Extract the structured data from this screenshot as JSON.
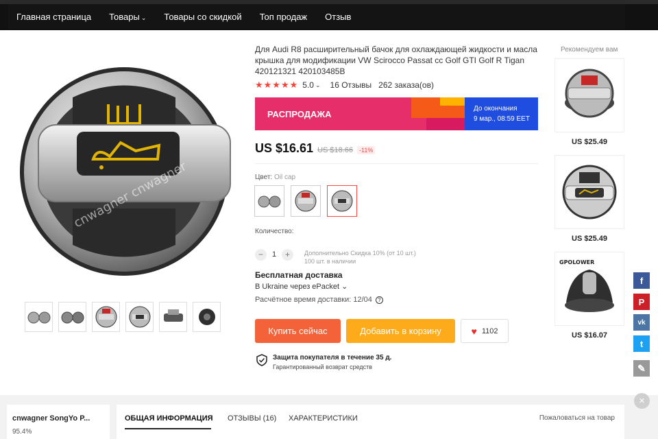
{
  "nav": {
    "items": [
      "Главная страница",
      "Товары",
      "Товары со скидкой",
      "Топ продаж",
      "Отзыв"
    ]
  },
  "product": {
    "title": "Для Audi R8 расширительный бачок для охлаждающей жидкости и масла крышка для модификации VW Scirocco Passat cc Golf GTI Golf R Tigan 420121321 420103485B",
    "stars": "★★★★★",
    "rating": "5.0",
    "reviews": "16 Отзывы",
    "orders": "262 заказа(ов)",
    "photo_watermark": "cnwagner cnwagner"
  },
  "sale": {
    "label": "РАСПРОДАЖА",
    "timer_title": "До окончания",
    "timer_value": "9 мар., 08:59 EET",
    "colors": {
      "banner": "#e62e6b",
      "timer": "#1e4de0"
    }
  },
  "price": {
    "current": "US $16.61",
    "old": "US $18.66",
    "discount": "-11%"
  },
  "color": {
    "label": "Цвет:",
    "value": "Oil cap",
    "selected_index": 2
  },
  "quantity": {
    "label": "Количество:",
    "value": "1",
    "minus": "−",
    "plus": "+",
    "note_line1": "Дополнительно Скидка 10% (от 10 шт.)",
    "note_line2": "100 шт. в наличии"
  },
  "shipping": {
    "title": "Бесплатная доставка",
    "destination": "В Ukraine через ePacket ⌄",
    "time": "Расчётное время доставки: 12/04",
    "help": "?"
  },
  "actions": {
    "buy": "Купить сейчас",
    "cart": "Добавить в корзину",
    "wishlist_count": "1102",
    "heart": "♥",
    "colors": {
      "buy": "#f4623a",
      "cart": "#fdab1b"
    }
  },
  "protection": {
    "title": "Защита покупателя в течение 35 д.",
    "subtitle": "Гарантированный возврат средств"
  },
  "recommended": {
    "title": "Рекомендуем вам",
    "items": [
      {
        "price": "US $25.49"
      },
      {
        "price": "US $25.49"
      },
      {
        "price": "US $16.07",
        "brand": "GPOLOWER"
      }
    ]
  },
  "social": [
    {
      "icon": "facebook-icon",
      "glyph": "f",
      "color": "#3b5998"
    },
    {
      "icon": "pinterest-icon",
      "glyph": "P",
      "color": "#cb2027"
    },
    {
      "icon": "vk-icon",
      "glyph": "vk",
      "color": "#4c75a3"
    },
    {
      "icon": "twitter-icon",
      "glyph": "t",
      "color": "#1da1f2"
    },
    {
      "icon": "edit-icon",
      "glyph": "✎",
      "color": "#999999"
    }
  ],
  "close": "×",
  "store": {
    "name": "cnwagner SongYo P...",
    "rating": "95.4%"
  },
  "tabs": {
    "overview": "ОБЩАЯ ИНФОРМАЦИЯ",
    "reviews": "ОТЗЫВЫ (16)",
    "specs": "ХАРАКТЕРИСТИКИ",
    "report": "Пожаловаться на товар"
  }
}
